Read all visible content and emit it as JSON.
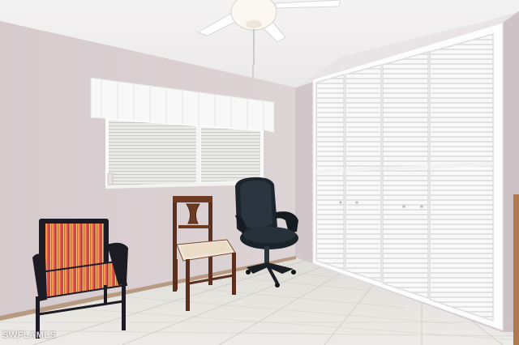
{
  "watermark": "SWFLAMLS",
  "colors": {
    "wall": "#d9cfd2",
    "ceiling": "#f1eff0",
    "floor_tile": "#e4e2dd",
    "closet_door": "#f7f7f7",
    "chair_stripe_red": "#e2594a",
    "office_chair": "#1f2a33"
  },
  "icons": [
    "ceiling-fan-icon",
    "window-blinds-icon",
    "valance-curtain-icon",
    "louvered-closet-doors-icon",
    "office-chair-icon",
    "striped-armchair-icon",
    "wooden-side-chair-icon"
  ]
}
